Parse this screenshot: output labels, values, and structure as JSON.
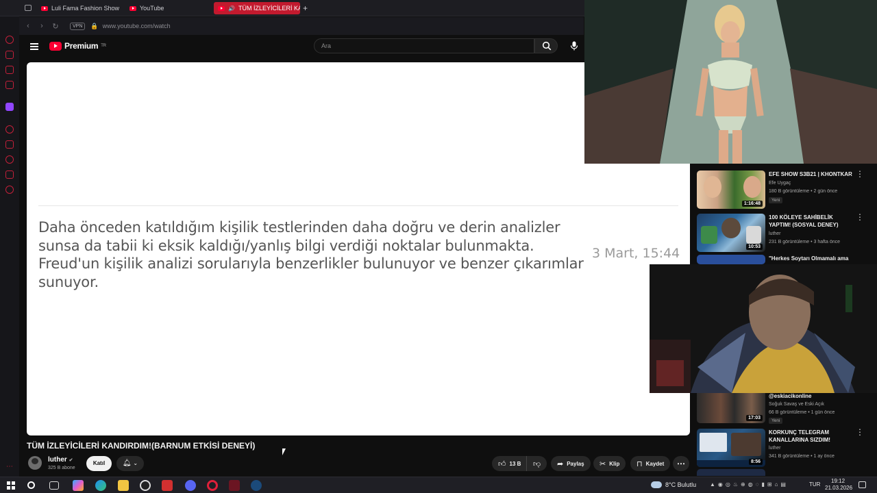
{
  "browser": {
    "tabs": [
      {
        "label": "Luli Fama Fashion Show S"
      },
      {
        "label": "YouTube"
      },
      {
        "label": "TÜM İZLEYİCİLERİ KAN"
      }
    ],
    "new_tab": "+",
    "vpn": "VPN",
    "url": "www.youtube.com/watch"
  },
  "header": {
    "logo": "Premium",
    "logo_region": "TR",
    "search_placeholder": "Ara"
  },
  "video": {
    "text": "Daha önceden katıldığım kişilik testlerinden daha doğru ve derin analizler sunsa da tabii ki eksik kaldığı/yanlış bilgi verdiği noktalar bulunmakta. Freud'un kişilik analizi sorularıyla benzerlikler bulunuyor ve benzer çıkarımlar sunuyor.",
    "date": "3 Mart, 15:44",
    "title": "TÜM İZLEYİCİLERİ KANDIRDIM!(BARNUM ETKİSİ DENEYİ)"
  },
  "channel": {
    "name": "luther",
    "subs": "325 B abone",
    "join": "Katıl"
  },
  "actions": {
    "likes": "13 B",
    "share": "Paylaş",
    "clip": "Klip",
    "save": "Kaydet"
  },
  "recs": [
    {
      "title": "EFE SHOW S3B21 | KHONTKAR",
      "channel": "Efe Uygaç",
      "meta": "180 B görüntüleme • 2 gün önce",
      "badge": "Yeni",
      "duration": "1:16:48"
    },
    {
      "title": "100 KÖLEYE SAHİBELİK YAPTIM! (SOSYAL DENEY)",
      "channel": "luther",
      "meta": "231 B görüntüleme • 3 hafta önce",
      "badge": "",
      "duration": "10:53"
    },
    {
      "title": "\"Herkes Soytarı Olmamalı ama",
      "channel": "",
      "meta": "",
      "badge": "",
      "duration": ""
    },
    {
      "title": "@eskiacikonline",
      "channel": "Soğuk Savaş ve Eski Açık",
      "meta": "66 B görüntüleme • 1 gün önce",
      "badge": "Yeni",
      "duration": "17:03"
    },
    {
      "title": "KORKUNÇ TELEGRAM KANALLARINA SIZDIM!",
      "channel": "luther",
      "meta": "341 B görüntüleme • 1 ay önce",
      "badge": "",
      "duration": "8:56"
    }
  ],
  "taskbar": {
    "weather": "8°C  Bulutlu",
    "lang": "TUR",
    "time": "19:12",
    "date": "21.03.2026"
  },
  "colors": {
    "accent": "#ff0033",
    "opera": "#c4203a",
    "background": "#0f0f0f"
  }
}
